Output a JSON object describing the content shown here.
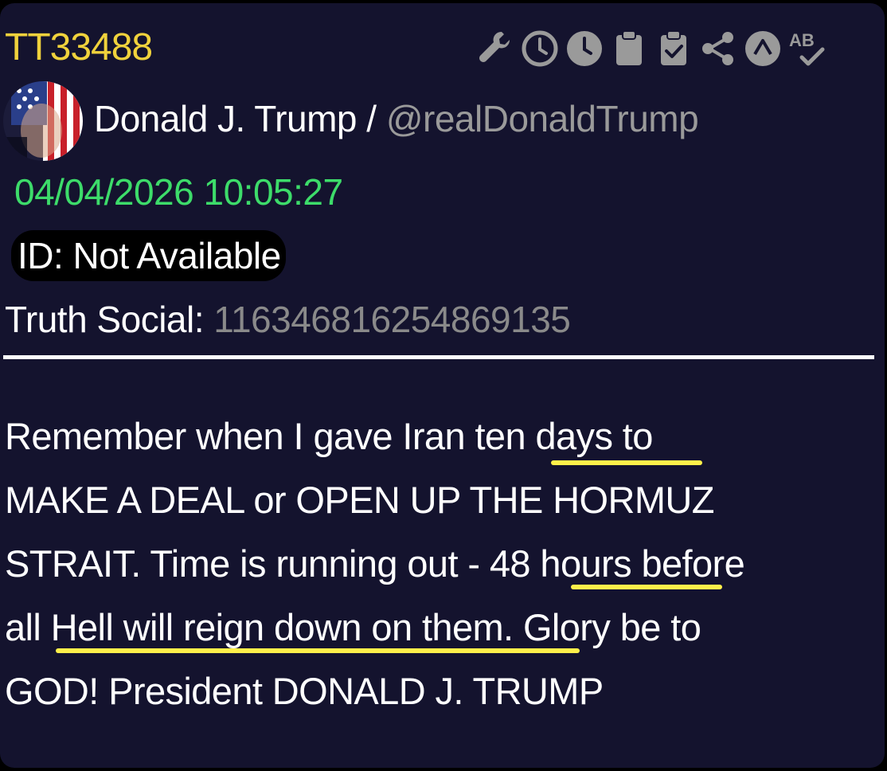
{
  "post": {
    "id": "TT33488",
    "author_name": "Donald J. Trump /",
    "author_handle": "@realDonaldTrump",
    "timestamp": "04/04/2026 10:05:27",
    "id_label": "ID: Not Available",
    "truth_social_label": "Truth Social:",
    "truth_social_id": "116346816254869135",
    "body_lines": [
      "Remember when I gave Iran ten days to",
      "MAKE A DEAL or OPEN UP THE HORMUZ",
      "STRAIT. Time is running out - 48 hours before",
      "all Hell will reign down on them. Glory be to",
      "GOD! President DONALD J. TRUMP"
    ],
    "highlighted_phrases": [
      "ten days",
      "48 hours",
      "Hell will reign down on them"
    ]
  },
  "toolbar": {
    "icons": [
      "wrench-icon",
      "clock-outline-icon",
      "clock-filled-icon",
      "clipboard-icon",
      "clipboard-check-icon",
      "share-icon",
      "caret-up-circle-icon",
      "spellcheck-icon"
    ],
    "spellcheck_text": "AB"
  },
  "colors": {
    "background": "#14132e",
    "post_id": "#f0d23c",
    "timestamp": "#3ddc6a",
    "handle": "#9a9a9a",
    "highlight": "#fff04a",
    "icon": "#9a9a9a"
  }
}
